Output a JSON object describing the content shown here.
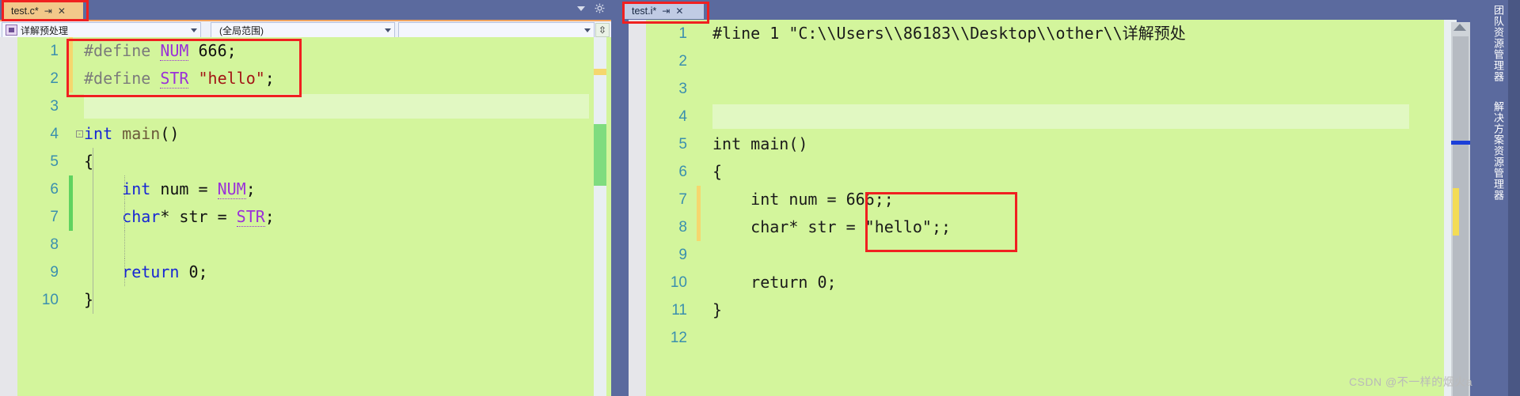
{
  "window": {
    "theme_accent": "#5b6a9e",
    "editor_background": "#d3f59c",
    "annotation_color": "#f02020"
  },
  "left_pane": {
    "tab": {
      "label": "test.c*",
      "pin_icon": "pin-icon",
      "close_icon": "close-icon"
    },
    "tabstrip_controls": {
      "dropdown_icon": "chevron-down-icon",
      "settings_icon": "gear-icon"
    },
    "navigation_bar": {
      "project_selector": {
        "value": "详解预处理",
        "icon": "project-icon",
        "dropdown_icon": "chevron-down-icon"
      },
      "member_selector": {
        "value": "(全局范围)",
        "dropdown_icon": "chevron-down-icon"
      },
      "third_selector": {
        "value": "",
        "dropdown_icon": "chevron-down-icon"
      },
      "split_window_button": "split-window-icon"
    },
    "code": {
      "language": "c",
      "lines": [
        {
          "n": "1",
          "change": "yellow",
          "fold": "",
          "tokens": [
            {
              "t": "#define ",
              "c": "pp"
            },
            {
              "t": "NUM",
              "c": "macro"
            },
            {
              "t": " ",
              "c": "plain"
            },
            {
              "t": "666",
              "c": "num"
            },
            {
              "t": ";",
              "c": "plain"
            }
          ]
        },
        {
          "n": "2",
          "change": "yellow",
          "fold": "",
          "tokens": [
            {
              "t": "#define ",
              "c": "pp"
            },
            {
              "t": "STR",
              "c": "macro"
            },
            {
              "t": " ",
              "c": "plain"
            },
            {
              "t": "\"hello\"",
              "c": "str"
            },
            {
              "t": ";",
              "c": "plain"
            }
          ]
        },
        {
          "n": "3",
          "change": "",
          "fold": "",
          "blank_highlight": true,
          "tokens": []
        },
        {
          "n": "4",
          "change": "",
          "fold": "-",
          "tokens": [
            {
              "t": "int ",
              "c": "type"
            },
            {
              "t": "main",
              "c": "fn"
            },
            {
              "t": "()",
              "c": "plain"
            }
          ]
        },
        {
          "n": "5",
          "change": "",
          "fold": "",
          "indent": true,
          "tokens": [
            {
              "t": "{",
              "c": "plain"
            }
          ]
        },
        {
          "n": "6",
          "change": "green",
          "fold": "",
          "indent": true,
          "indent2": true,
          "tokens": [
            {
              "t": "    ",
              "c": "plain"
            },
            {
              "t": "int ",
              "c": "type"
            },
            {
              "t": "num = ",
              "c": "plain"
            },
            {
              "t": "NUM",
              "c": "macro"
            },
            {
              "t": ";",
              "c": "plain"
            }
          ]
        },
        {
          "n": "7",
          "change": "green",
          "fold": "",
          "indent": true,
          "indent2": true,
          "tokens": [
            {
              "t": "    ",
              "c": "plain"
            },
            {
              "t": "char",
              "c": "type"
            },
            {
              "t": "* str = ",
              "c": "plain"
            },
            {
              "t": "STR",
              "c": "macro"
            },
            {
              "t": ";",
              "c": "plain"
            }
          ]
        },
        {
          "n": "8",
          "change": "",
          "fold": "",
          "indent": true,
          "indent2": true,
          "tokens": []
        },
        {
          "n": "9",
          "change": "",
          "fold": "",
          "indent": true,
          "indent2": true,
          "tokens": [
            {
              "t": "    ",
              "c": "plain"
            },
            {
              "t": "return ",
              "c": "type"
            },
            {
              "t": "0",
              "c": "num"
            },
            {
              "t": ";",
              "c": "plain"
            }
          ]
        },
        {
          "n": "10",
          "change": "",
          "fold": "",
          "indent": true,
          "tokens": [
            {
              "t": "}",
              "c": "plain"
            }
          ]
        }
      ]
    },
    "scrollbar": {
      "thumb": "vertical-scroll-thumb",
      "change_marker": "yellow-change-marker"
    }
  },
  "right_pane": {
    "tab": {
      "label": "test.i*",
      "pin_icon": "pin-icon",
      "close_icon": "close-icon"
    },
    "code": {
      "language": "preprocessed-c",
      "lines": [
        {
          "n": "1",
          "change": "",
          "text": "#line 1 \"C:\\\\Users\\\\86183\\\\Desktop\\\\other\\\\详解预处"
        },
        {
          "n": "2",
          "change": "",
          "text": ""
        },
        {
          "n": "3",
          "change": "",
          "text": ""
        },
        {
          "n": "4",
          "change": "",
          "blank_highlight": true,
          "text": ""
        },
        {
          "n": "5",
          "change": "",
          "text": "int main()"
        },
        {
          "n": "6",
          "change": "",
          "text": "{"
        },
        {
          "n": "7",
          "change": "yellow",
          "text": "    int num = 666;;"
        },
        {
          "n": "8",
          "change": "yellow",
          "text": "    char* str = \"hello\";;"
        },
        {
          "n": "9",
          "change": "",
          "text": ""
        },
        {
          "n": "10",
          "change": "",
          "text": "    return 0;"
        },
        {
          "n": "11",
          "change": "",
          "text": "}"
        },
        {
          "n": "12",
          "change": "",
          "text": ""
        }
      ]
    },
    "overview_scrollbar": {
      "scroll_up_icon": "scroll-up-arrow-icon",
      "markers": [
        "blue-caret-marker",
        "yellow-change-marker"
      ]
    }
  },
  "right_rail": {
    "tabs": [
      {
        "label": "团队资源管理器"
      },
      {
        "label": "解决方案资源管理器"
      }
    ]
  },
  "annotations": {
    "boxes": [
      "tab-test-c",
      "define-block",
      "tab-test-i",
      "expanded-macro-block"
    ]
  },
  "watermark": {
    "text": "CSDN @不一样的烟火a"
  }
}
